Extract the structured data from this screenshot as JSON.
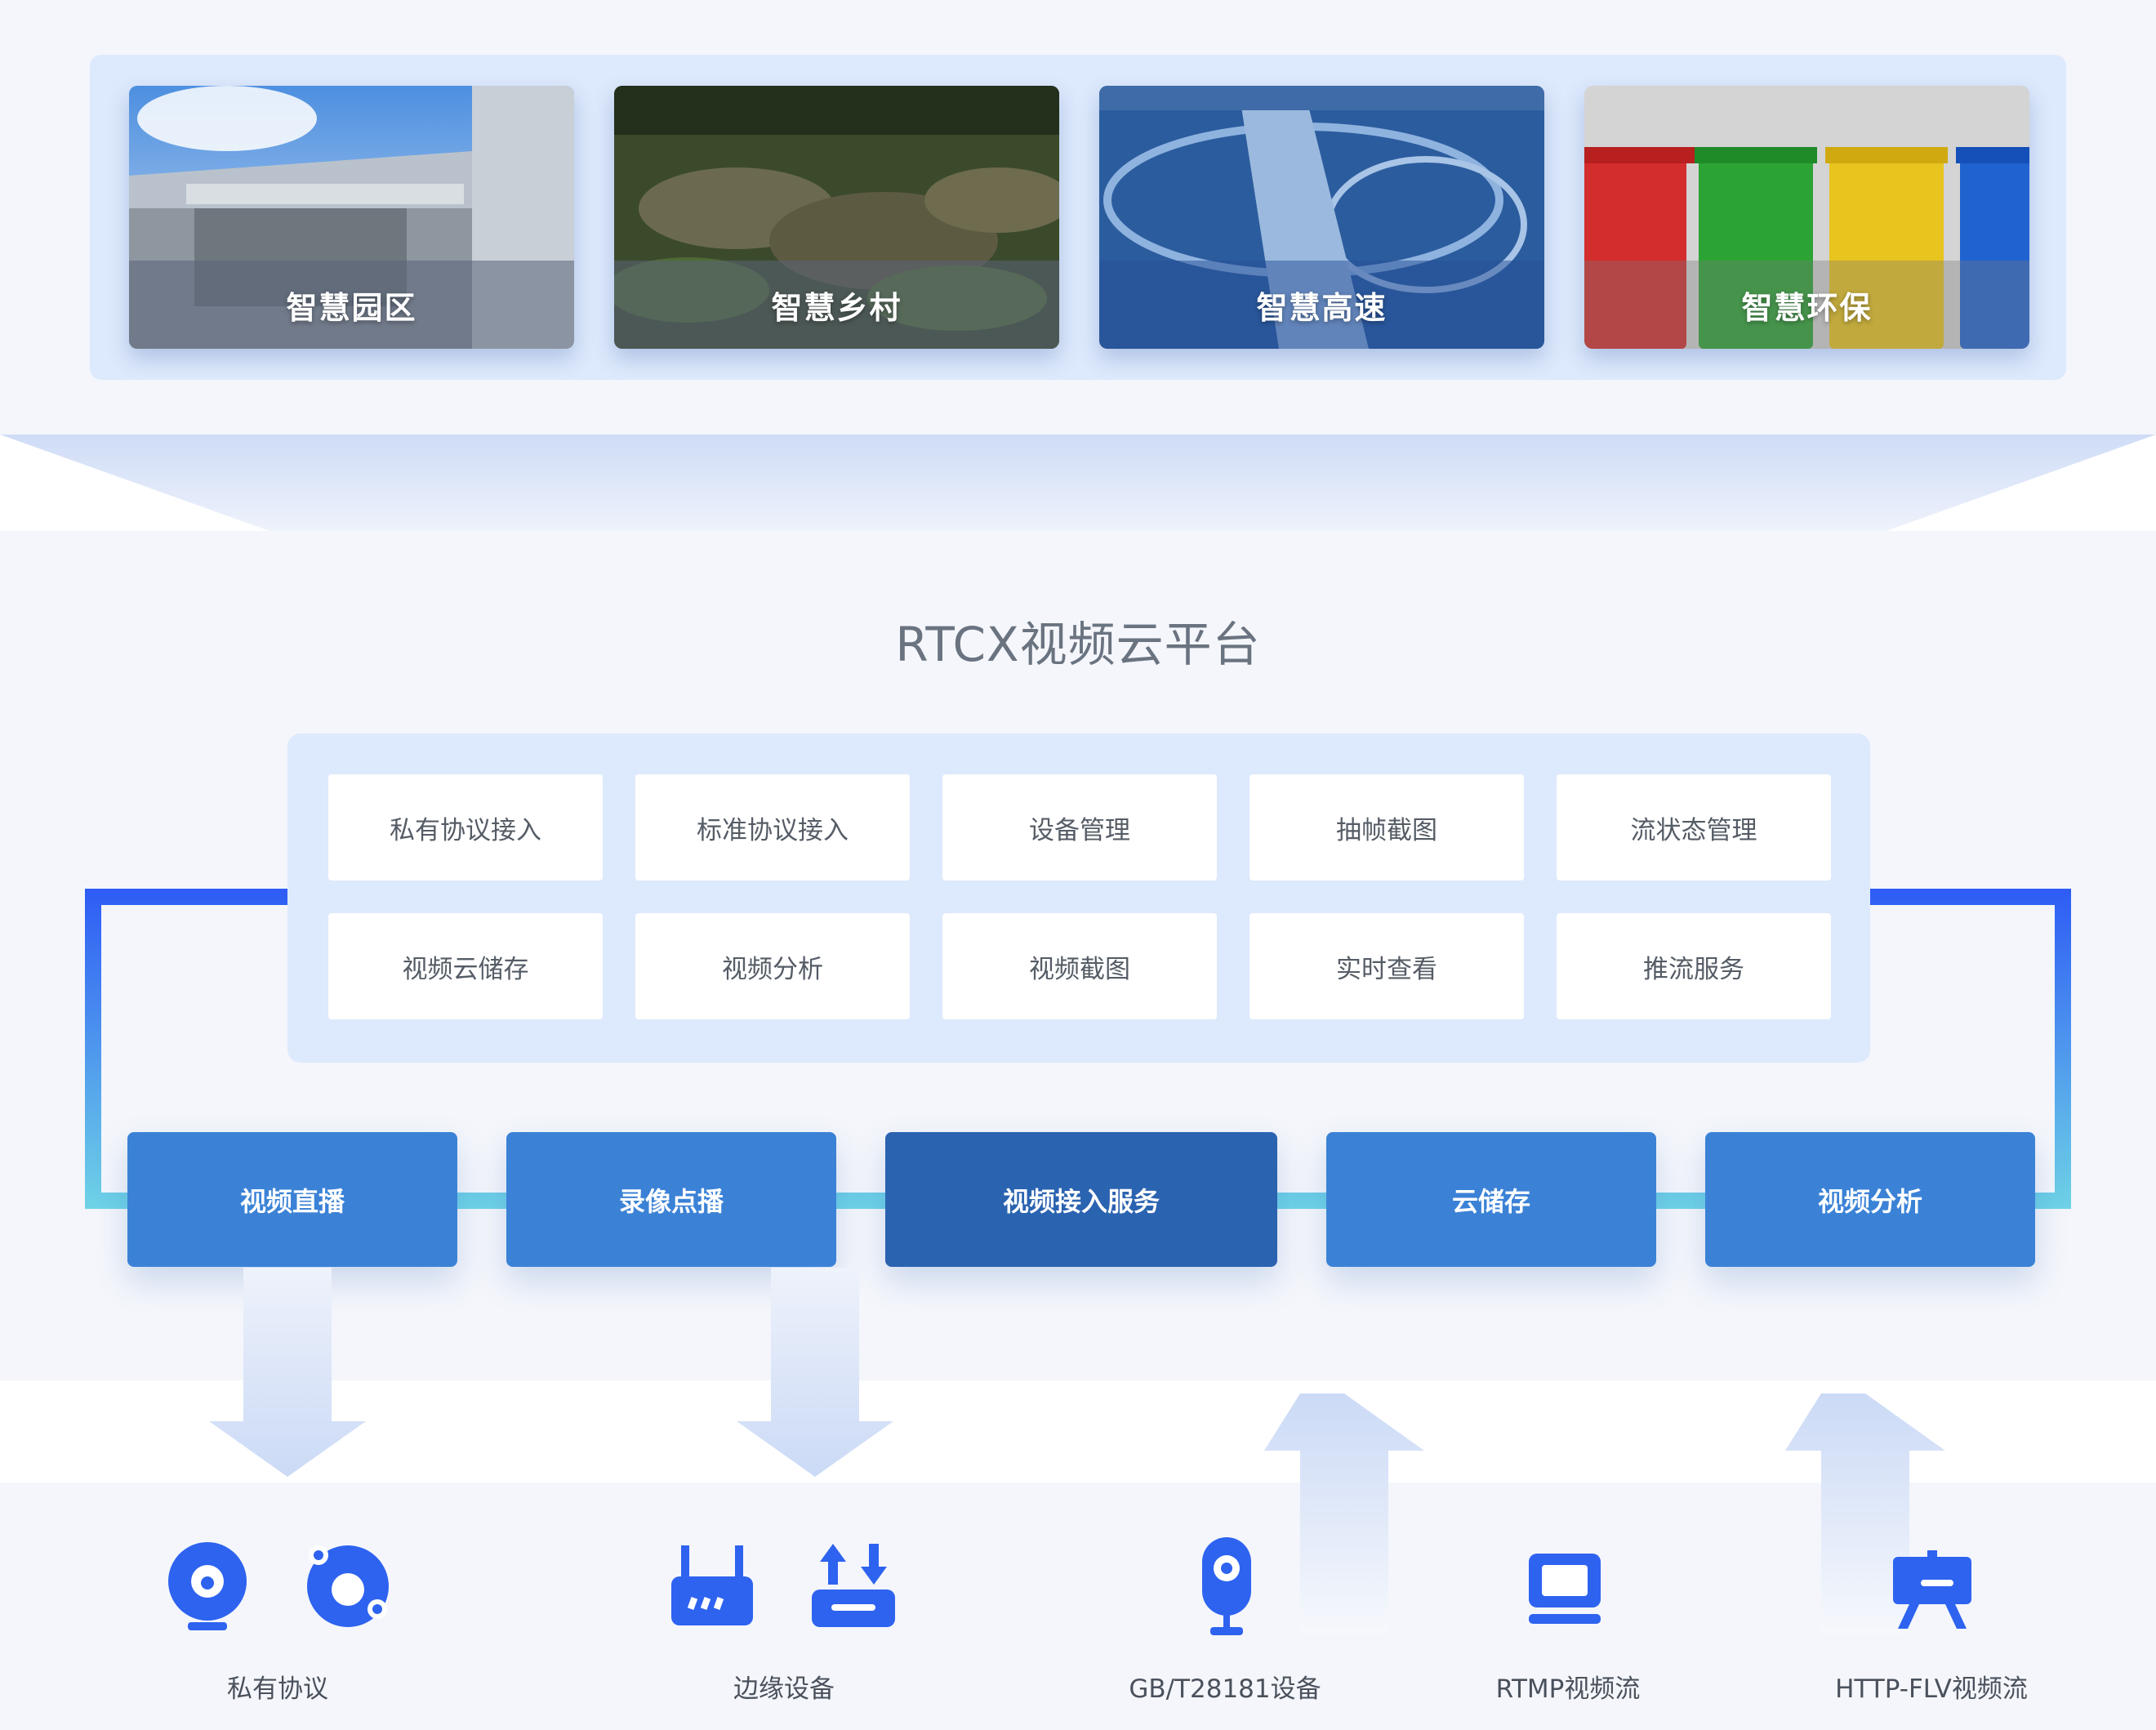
{
  "scenarios": [
    {
      "label": "智慧园区"
    },
    {
      "label": "智慧乡村"
    },
    {
      "label": "智慧高速"
    },
    {
      "label": "智慧环保"
    }
  ],
  "platform": {
    "title": "RTCX视频云平台",
    "services_row1": [
      "私有协议接入",
      "标准协议接入",
      "设备管理",
      "抽帧截图",
      "流状态管理"
    ],
    "services_row2": [
      "视频云储存",
      "视频分析",
      "视频截图",
      "实时查看",
      "推流服务"
    ]
  },
  "bus": [
    "视频直播",
    "录像点播",
    "视频接入服务",
    "云储存",
    "视频分析"
  ],
  "devices": [
    "私有协议",
    "边缘设备",
    "GB/T28181设备",
    "RTMP视频流",
    "HTTP-FLV视频流"
  ],
  "icons": [
    "camera-icon",
    "orbit-icon",
    "router-icon",
    "upload-download-icon",
    "ip-camera-icon",
    "monitor-icon",
    "easel-icon"
  ],
  "colors": {
    "accent": "#3b82d6",
    "core": "#2a63b0",
    "icon": "#2e63f0",
    "loop_top": "#2e5cf5",
    "loop_bottom": "#6fd3e6"
  }
}
